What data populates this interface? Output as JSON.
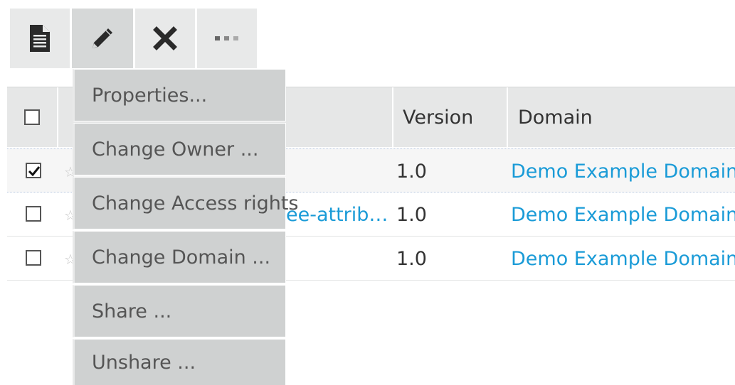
{
  "toolbar": {
    "buttons": [
      {
        "name": "new-document-button",
        "icon": "document-icon"
      },
      {
        "name": "edit-button",
        "icon": "pencil-icon"
      },
      {
        "name": "delete-button",
        "icon": "close-icon"
      },
      {
        "name": "more-button",
        "icon": "more-icon"
      }
    ]
  },
  "table": {
    "columns": {
      "version": "Version",
      "domain": "Domain"
    },
    "rows": [
      {
        "checked": true,
        "name": "",
        "version": "1.0",
        "domain": "Demo Example Domain"
      },
      {
        "checked": false,
        "name": "ee-attrib…",
        "version": "1.0",
        "domain": "Demo Example Domain"
      },
      {
        "checked": false,
        "name": "",
        "version": "1.0",
        "domain": "Demo Example Domain"
      }
    ]
  },
  "menu": {
    "items": [
      "Properties...",
      "Change Owner ...",
      "Change Access rights",
      "Change Domain ...",
      "Share ...",
      "Unshare ..."
    ]
  },
  "colors": {
    "link": "#1a9bd7",
    "menu_bg": "#cfd1d1",
    "header_bg": "#e6e7e7"
  }
}
